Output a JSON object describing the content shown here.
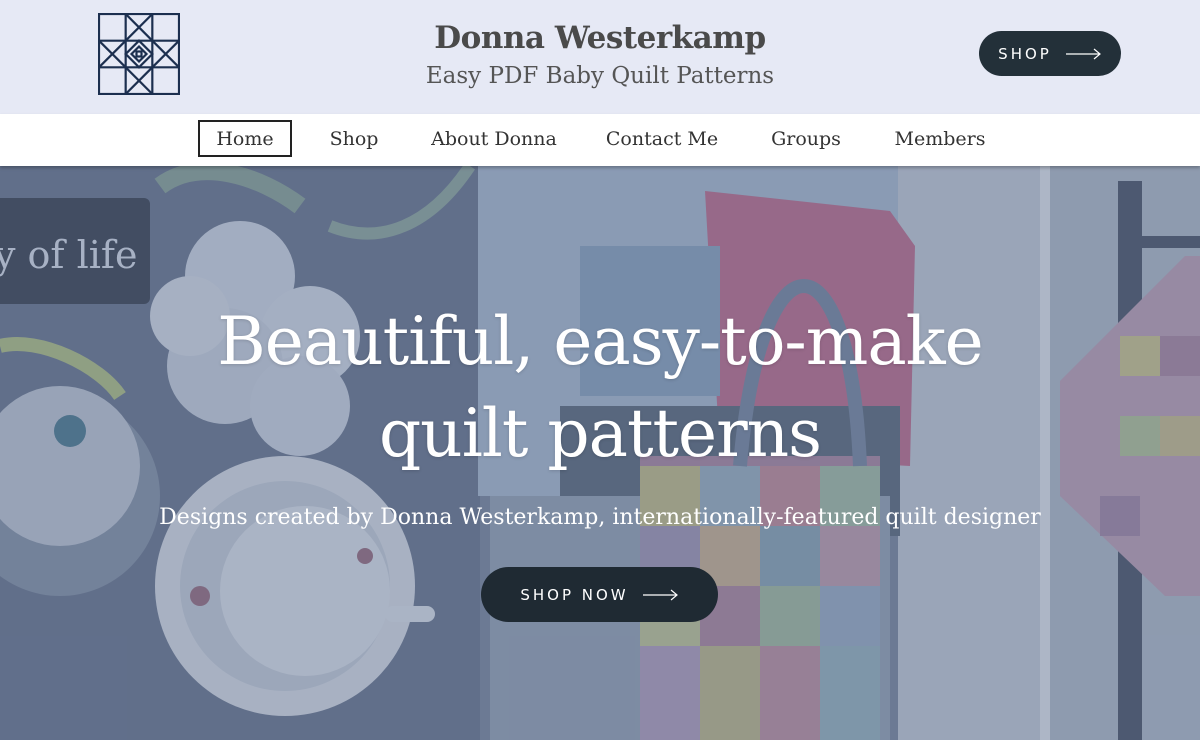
{
  "brand": {
    "name": "Donna Westerkamp",
    "tagline": "Easy PDF Baby Quilt Patterns"
  },
  "header": {
    "shop_label": "SHOP"
  },
  "nav": {
    "items": [
      {
        "label": "Home",
        "active": true
      },
      {
        "label": "Shop"
      },
      {
        "label": "About Donna"
      },
      {
        "label": "Contact Me"
      },
      {
        "label": "Groups"
      },
      {
        "label": "Members"
      }
    ]
  },
  "hero": {
    "title_line1": "Beautiful, easy-to-make",
    "title_line2": "quilt patterns",
    "subtitle": "Designs created by Donna Westerkamp, internationally-featured quilt designer",
    "cta_label": "SHOP NOW",
    "sign_text": "y of life"
  },
  "colors": {
    "header_bg": "#e6e9f5",
    "button_dark": "#233039",
    "logo_navy": "#1c2f4f"
  },
  "icons": {
    "logo": "quilt-block-logo",
    "arrow": "arrow-right-icon"
  }
}
